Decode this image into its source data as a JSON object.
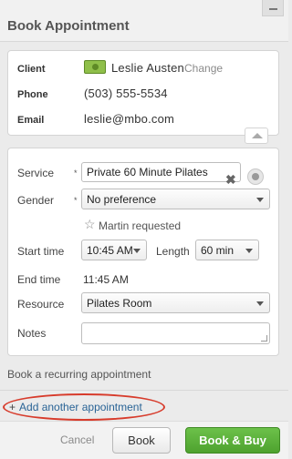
{
  "header": {
    "title": "Book Appointment"
  },
  "client": {
    "client_label": "Client",
    "client_name": "Leslie Austen",
    "change_label": "Change",
    "phone_label": "Phone",
    "phone_value": "(503) 555-5534",
    "email_label": "Email",
    "email_value": "leslie@mbo.com",
    "icon": "money-icon"
  },
  "form": {
    "required_marker": "*",
    "service_label": "Service",
    "service_value": "Private 60 Minute Pilates",
    "clear_symbol": "✖",
    "gender_label": "Gender",
    "gender_value": "No preference",
    "star_symbol": "☆",
    "requested_text": "Martin requested",
    "start_label": "Start time",
    "start_value": "10:45 AM",
    "length_label": "Length",
    "length_value": "60 min",
    "end_label": "End time",
    "end_value": "11:45 AM",
    "resource_label": "Resource",
    "resource_value": "Pilates Room",
    "notes_label": "Notes",
    "notes_value": ""
  },
  "links": {
    "recurring": "Book a recurring appointment",
    "add_plus": "+",
    "add_another": "Add another appointment"
  },
  "footer": {
    "cancel": "Cancel",
    "book": "Book",
    "book_and_buy": "Book & Buy"
  },
  "colors": {
    "accent_green": "#5cb33c",
    "link_blue": "#2a6496",
    "highlight_red": "#d73b2b"
  }
}
